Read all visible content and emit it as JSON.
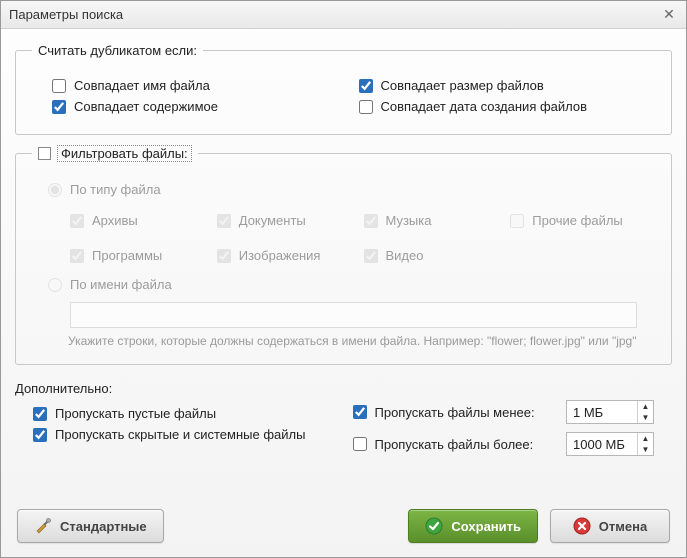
{
  "window": {
    "title": "Параметры поиска"
  },
  "group_duplicate": {
    "legend": "Считать дубликатом если:",
    "match_name": {
      "label": "Совпадает имя файла",
      "checked": false
    },
    "match_content": {
      "label": "Совпадает содержимое",
      "checked": true
    },
    "match_size": {
      "label": "Совпадает размер файлов",
      "checked": true
    },
    "match_date": {
      "label": "Совпадает дата создания файлов",
      "checked": false
    }
  },
  "group_filter": {
    "enabled": false,
    "legend": "Фильтровать файлы:",
    "by_type": {
      "label": "По типу файла",
      "selected": true,
      "types": {
        "archives": {
          "label": "Архивы",
          "checked": true
        },
        "programs": {
          "label": "Программы",
          "checked": true
        },
        "documents": {
          "label": "Документы",
          "checked": true
        },
        "images": {
          "label": "Изображения",
          "checked": true
        },
        "music": {
          "label": "Музыка",
          "checked": true
        },
        "video": {
          "label": "Видео",
          "checked": true
        },
        "other": {
          "label": "Прочие файлы",
          "checked": false
        }
      }
    },
    "by_name": {
      "label": "По имени файла",
      "selected": false,
      "value": "",
      "hint": "Укажите строки, которые должны содержаться в имени файла. Например: \"flower; flower.jpg\" или \"jpg\""
    }
  },
  "group_additional": {
    "legend": "Дополнительно:",
    "skip_empty": {
      "label": "Пропускать пустые файлы",
      "checked": true
    },
    "skip_hidden": {
      "label": "Пропускать скрытые и системные файлы",
      "checked": true
    },
    "skip_less": {
      "label": "Пропускать файлы менее:",
      "checked": true,
      "value": "1 МБ"
    },
    "skip_more": {
      "label": "Пропускать файлы более:",
      "checked": false,
      "value": "1000 МБ"
    }
  },
  "buttons": {
    "defaults": "Стандартные",
    "save": "Сохранить",
    "cancel": "Отмена"
  }
}
